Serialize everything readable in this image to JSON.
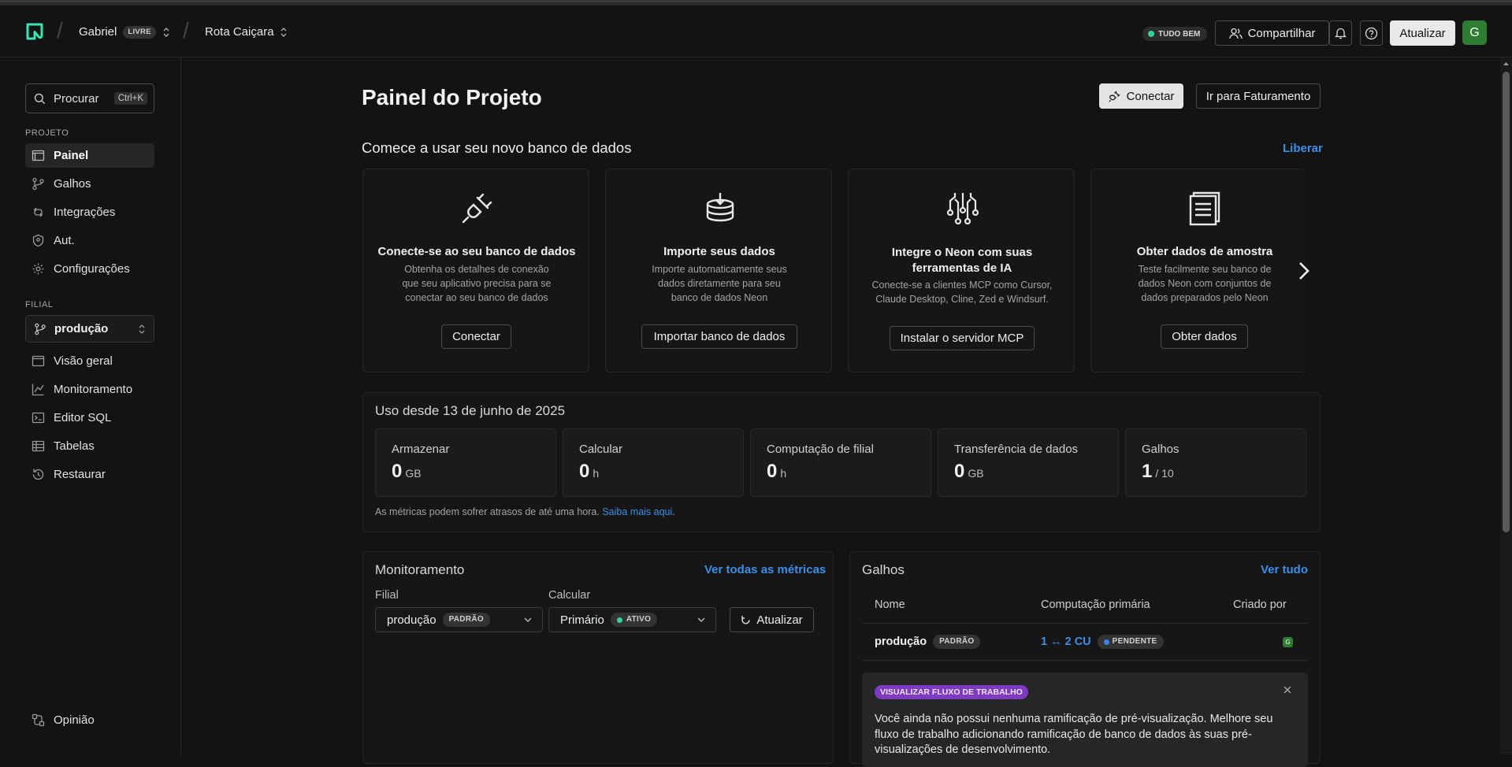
{
  "header": {
    "user_name": "Gabriel",
    "plan_badge": "LIVRE",
    "project_name": "Rota Caiçara",
    "status_badge": "TUDO BEM",
    "share_label": "Compartilhar",
    "upgrade_label": "Atualizar",
    "avatar_initial": "G"
  },
  "sidebar": {
    "search_label": "Procurar",
    "search_shortcut": "Ctrl+K",
    "project_section": "PROJETO",
    "project_items": [
      {
        "label": "Painel",
        "icon": "dashboard-icon",
        "active": true
      },
      {
        "label": "Galhos",
        "icon": "branch-icon"
      },
      {
        "label": "Integrações",
        "icon": "integrations-icon"
      },
      {
        "label": "Aut.",
        "icon": "shield-icon"
      },
      {
        "label": "Configurações",
        "icon": "gear-icon"
      }
    ],
    "branch_section": "FILIAL",
    "branch_selector": "produção",
    "branch_items": [
      {
        "label": "Visão geral",
        "icon": "overview-icon"
      },
      {
        "label": "Monitoramento",
        "icon": "chart-line-icon"
      },
      {
        "label": "Editor SQL",
        "icon": "terminal-icon"
      },
      {
        "label": "Tabelas",
        "icon": "table-icon"
      },
      {
        "label": "Restaurar",
        "icon": "restore-icon"
      }
    ],
    "feedback_label": "Opinião"
  },
  "main": {
    "page_title": "Painel do Projeto",
    "connect_label": "Conectar",
    "billing_label": "Ir para Faturamento",
    "getting_started": {
      "title": "Comece a usar seu novo banco de dados",
      "dismiss_label": "Liberar",
      "cards": [
        {
          "icon": "plug-icon",
          "title": "Conecte-se ao seu banco de dados",
          "desc": "Obtenha os detalhes de conexão que seu aplicativo precisa para se conectar ao seu banco de dados",
          "button": "Conectar"
        },
        {
          "icon": "database-import-icon",
          "title": "Importe seus dados",
          "desc": "Importe automaticamente seus dados diretamente para seu banco de dados Neon",
          "button": "Importar banco de dados"
        },
        {
          "icon": "ai-circuit-icon",
          "title": "Integre o Neon com suas ferramentas de IA",
          "desc": "Conecte-se a clientes MCP como Cursor, Claude Desktop, Cline, Zed e Windsurf.",
          "button": "Instalar o servidor MCP"
        },
        {
          "icon": "document-icon",
          "title": "Obter dados de amostra",
          "desc": "Teste facilmente seu banco de dados Neon com conjuntos de dados preparados pelo Neon",
          "button": "Obter dados"
        }
      ]
    },
    "usage": {
      "title": "Uso desde 13 de junho de 2025",
      "metrics": [
        {
          "label": "Armazenar",
          "value": "0",
          "unit": "GB"
        },
        {
          "label": "Calcular",
          "value": "0",
          "unit": "h"
        },
        {
          "label": "Computação de filial",
          "value": "0",
          "unit": "h"
        },
        {
          "label": "Transferência de dados",
          "value": "0",
          "unit": "GB"
        },
        {
          "label": "Galhos",
          "value": "1",
          "unit": "/ 10"
        }
      ],
      "footnote": "As métricas podem sofrer atrasos de até uma hora.",
      "footnote_link": "Saiba mais aqui"
    },
    "monitoring": {
      "title": "Monitoramento",
      "all_metrics_link": "Ver todas as métricas",
      "branch_label": "Filial",
      "branch_value": "produção",
      "branch_badge": "PADRÃO",
      "compute_label": "Calcular",
      "compute_value": "Primário",
      "compute_badge": "ATIVO",
      "refresh_label": "Atualizar"
    },
    "branches": {
      "title": "Galhos",
      "view_all": "Ver tudo",
      "columns": [
        "Nome",
        "Computação primária",
        "Criado por"
      ],
      "row": {
        "name": "produção",
        "badge": "PADRÃO",
        "compute": "1 ↔ 2 CU",
        "status": "PENDENTE",
        "creator_initial": "G"
      },
      "preview": {
        "badge": "VISUALIZAR FLUXO DE TRABALHO",
        "text": "Você ainda não possui nenhuma ramificação de pré-visualização. Melhore seu fluxo de trabalho adicionando ramificação de banco de dados às suas pré-visualizações de desenvolvimento."
      }
    }
  },
  "colors": {
    "accent_link": "#3b8fe8",
    "status_green": "#34d399",
    "preview_purple": "#a855f7",
    "avatar_green": "#2f7d32"
  }
}
